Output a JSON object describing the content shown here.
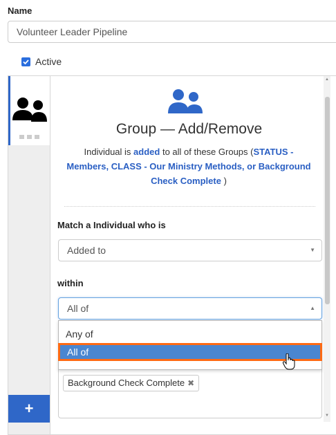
{
  "form": {
    "name_label": "Name",
    "name_value": "Volunteer Leader Pipeline",
    "active_label": "Active",
    "active_checked": true
  },
  "sidebar": {
    "add_label": "+"
  },
  "action": {
    "title": "Group — Add/Remove",
    "desc_prefix": "Individual is ",
    "desc_verb": "added",
    "desc_middle": " to all of these Groups (",
    "desc_groups": "STATUS - Members, CLASS - Our Ministry Methods, or Background Check Complete",
    "desc_suffix": " )"
  },
  "match": {
    "label": "Match a Individual who is",
    "value": "Added to"
  },
  "within": {
    "label": "within",
    "value": "All of",
    "options": [
      "Any of",
      "All of"
    ],
    "highlighted": "All of"
  },
  "groups": {
    "tags": [
      "Background Check Complete"
    ]
  },
  "colors": {
    "accent": "#2f67c8",
    "link_blue": "#2a5fc3",
    "highlight": "#4a86d0",
    "highlight_border": "#ff6a13"
  }
}
